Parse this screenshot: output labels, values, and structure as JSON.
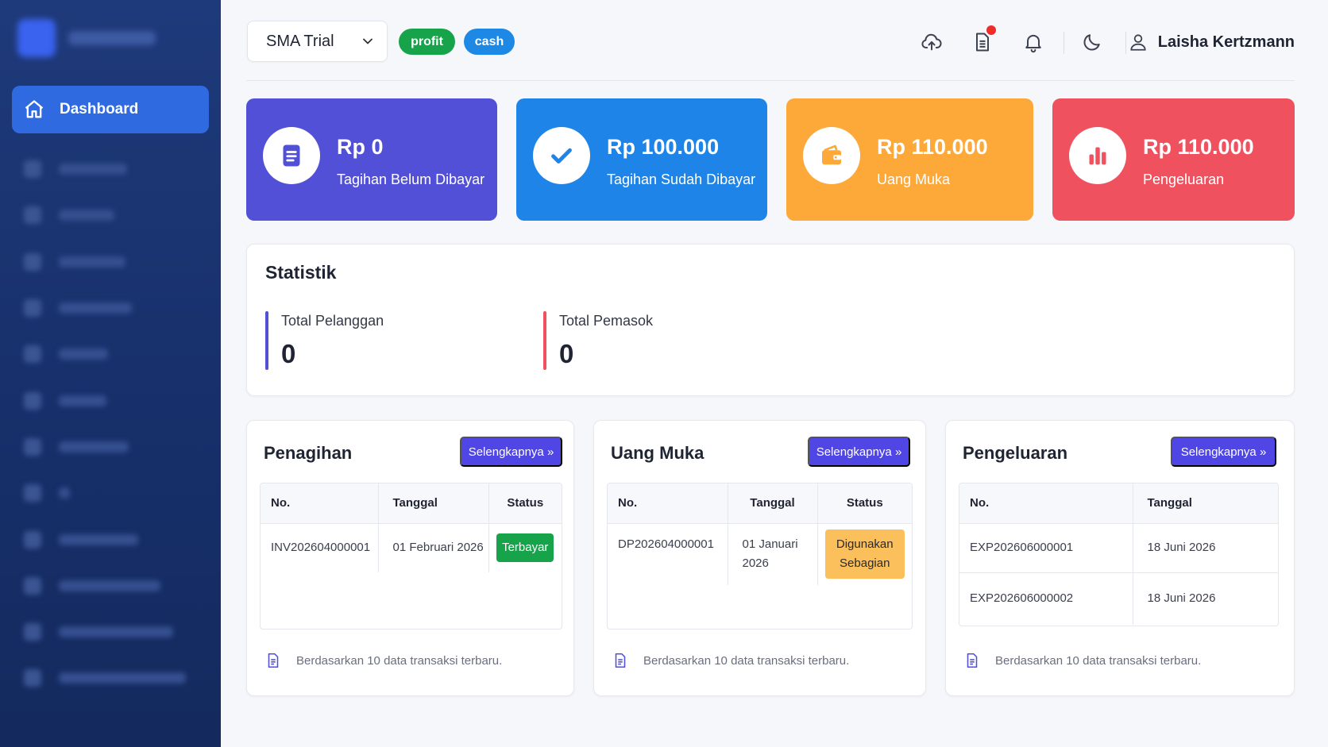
{
  "colors": {
    "sidebar": "#1f3a7a",
    "active_nav": "#2f6ae0",
    "card_purple": "#5150d6",
    "card_blue": "#1e84e8",
    "card_orange": "#fca93a",
    "card_red": "#f0515f",
    "button": "#4f46e5",
    "success": "#16a34a"
  },
  "sidebar": {
    "active_item": {
      "label": "Dashboard",
      "icon": "home-icon"
    }
  },
  "header": {
    "school_select": "SMA Trial",
    "pills": {
      "profit": "profit",
      "cash": "cash"
    },
    "icons": [
      "cloud-upload-icon",
      "document-icon",
      "bell-icon",
      "moon-icon",
      "user-icon"
    ],
    "user_name": "Laisha Kertzmann"
  },
  "summary_cards": [
    {
      "amount": "Rp 0",
      "label": "Tagihan Belum Dibayar",
      "icon": "document-icon"
    },
    {
      "amount": "Rp 100.000",
      "label": "Tagihan Sudah Dibayar",
      "icon": "check-icon"
    },
    {
      "amount": "Rp 110.000",
      "label": "Uang Muka",
      "icon": "wallet-icon"
    },
    {
      "amount": "Rp 110.000",
      "label": "Pengeluaran",
      "icon": "bar-chart-icon"
    }
  ],
  "statistik": {
    "title": "Statistik",
    "items": [
      {
        "label": "Total Pelanggan",
        "value": "0"
      },
      {
        "label": "Total Pemasok",
        "value": "0"
      }
    ]
  },
  "panels": {
    "footer_note": "Berdasarkan 10 data transaksi terbaru.",
    "more_label": "Selengkapnya »",
    "penagihan": {
      "title": "Penagihan",
      "columns": [
        "No.",
        "Tanggal",
        "Status"
      ],
      "rows": [
        {
          "no": "INV202604000001",
          "tanggal": "01 Februari 2026",
          "status": "Terbayar"
        }
      ]
    },
    "uang_muka": {
      "title": "Uang Muka",
      "columns": [
        "No.",
        "Tanggal",
        "Status"
      ],
      "rows": [
        {
          "no": "DP202604000001",
          "tanggal_1": "01 Januari",
          "tanggal_2": "2026",
          "status_1": "Digunakan",
          "status_2": "Sebagian"
        }
      ]
    },
    "pengeluaran": {
      "title": "Pengeluaran",
      "columns": [
        "No.",
        "Tanggal"
      ],
      "rows": [
        {
          "no": "EXP202606000001",
          "tanggal": "18 Juni 2026"
        },
        {
          "no": "EXP202606000002",
          "tanggal": "18 Juni 2026"
        }
      ]
    }
  }
}
